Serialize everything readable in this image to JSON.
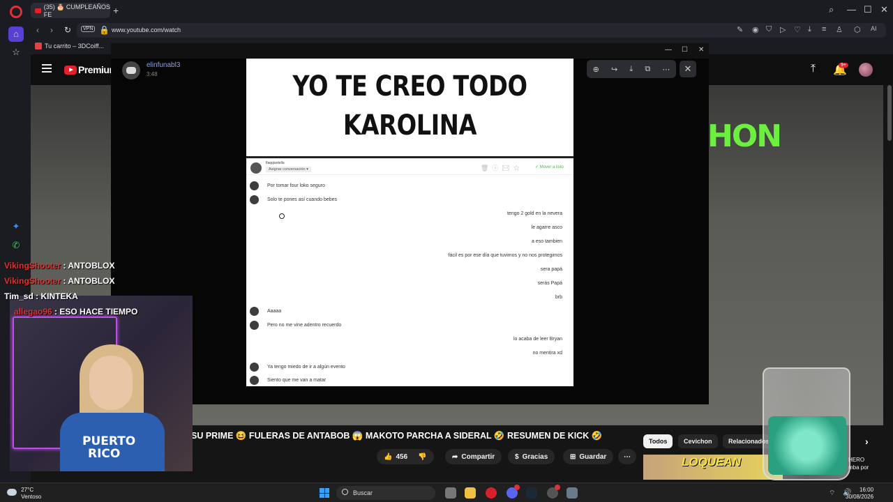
{
  "browser": {
    "tab_title": "(35) 🎂 CUMPLEAÑOS FE",
    "url": "www.youtube.com/watch",
    "vpn_label": "VPN",
    "bookmark": "Tu carrito – 3DCoiff...",
    "ai_label": "AI"
  },
  "youtube": {
    "brand": "Premium",
    "notif_count": "9+",
    "overlay_text": "HON",
    "ticker": "SU PRIME 😆 FULERAS DE ANTABOB 😱 MAKOTO PARCHA A SIDERAL 🤣 RESUMEN DE KICK 🤣",
    "likes": "456",
    "share_label": "Compartir",
    "thanks_label": "Gracias",
    "save_label": "Guardar",
    "more_label": "⋯",
    "chips": [
      "Todos",
      "Cevichon",
      "Relacionados"
    ],
    "thumb_text": "LOQUEAN",
    "side_title_1": "HERO",
    "side_title_2": "mba por"
  },
  "chat": [
    {
      "user": "VikingShooter",
      "text": " : ANTOBLOX"
    },
    {
      "user": "VikingShooter",
      "text": " : ANTOBLOX"
    },
    {
      "user": "Tim_sd",
      "text": " : KINTEKA",
      "user_white": true
    },
    {
      "user": "allegao96",
      "text": " : ESO HACE TIEMPO"
    }
  ],
  "webcam": {
    "shirt_line1": "PUERTO",
    "shirt_line2": "RICO"
  },
  "discord": {
    "username": "elinfunabl3",
    "time": "3:48"
  },
  "meme": {
    "line1": "YO TE CREO TODO",
    "line2": "KAROLINA",
    "assign": "Asignar conversación ▾",
    "sender": "flaqqiaotella",
    "move": "✓ Mover a listo",
    "messages_left_1": [
      "Por tomar four loko seguro",
      "Solo te pones así cuando bebes"
    ],
    "messages_right_1": [
      "tengo 2 gold en la nevera",
      "le agarre asco",
      "a eso tambien",
      "fácil es por ese día que tuvimos y no nos protegimos",
      "sera papá",
      "serás Papá",
      "brb"
    ],
    "messages_left_2": [
      "Aaaaa",
      "Pero no me vine adentro recuerdo"
    ],
    "messages_right_2": [
      "lo acaba de leer Bryan",
      "no mentira xd"
    ],
    "messages_left_3": [
      "Ya tengo miedo de ir a algún evento",
      "Siento que me van a matar"
    ]
  },
  "taskbar": {
    "temp": "27°C",
    "weather": "Ventoso",
    "search_placeholder": "Buscar",
    "time": "16:00",
    "date": "30/08/2026"
  }
}
